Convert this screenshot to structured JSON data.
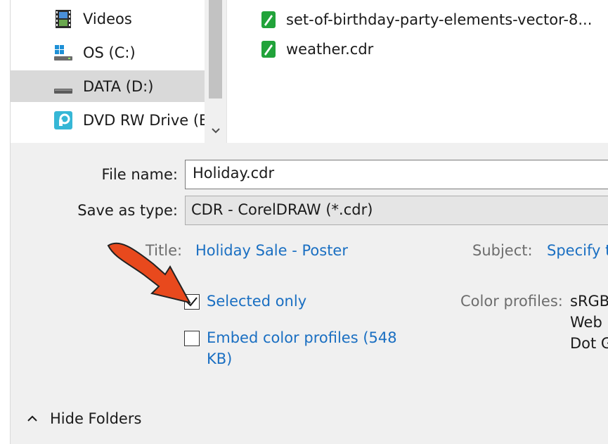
{
  "nav": {
    "items": [
      {
        "label": "Videos",
        "icon": "film-icon"
      },
      {
        "label": "OS (C:)",
        "icon": "windows-drive-icon"
      },
      {
        "label": "DATA (D:)",
        "icon": "drive-icon",
        "selected": true
      },
      {
        "label": "DVD RW Drive (E",
        "icon": "dvd-drive-icon"
      }
    ]
  },
  "files": {
    "items": [
      {
        "label": "set-of-birthday-party-elements-vector-8...",
        "icon": "cdr-file-icon"
      },
      {
        "label": "weather.cdr",
        "icon": "cdr-file-icon"
      }
    ]
  },
  "form": {
    "file_name_label": "File name:",
    "file_name_value": "Holiday.cdr",
    "save_type_label": "Save as type:",
    "save_type_value": "CDR - CorelDRAW (*.cdr)"
  },
  "meta": {
    "title_label": "Title:",
    "title_value": "Holiday Sale - Poster",
    "subject_label": "Subject:",
    "subject_value": "Specify t"
  },
  "options": {
    "selected_only_label": "Selected only",
    "selected_only_checked": true,
    "embed_profiles_label": "Embed color profiles (548 KB)",
    "embed_profiles_checked": false,
    "color_profiles_label": "Color profiles:",
    "color_profiles_lines": [
      "sRGB",
      "Web",
      "Dot G"
    ]
  },
  "footer": {
    "hide_folders_label": "Hide Folders"
  },
  "colors": {
    "link": "#1a6fc2",
    "annotation_arrow": "#e8491d",
    "selected_bg": "#d9d9d9",
    "panel_bg": "#f0f0f0"
  }
}
